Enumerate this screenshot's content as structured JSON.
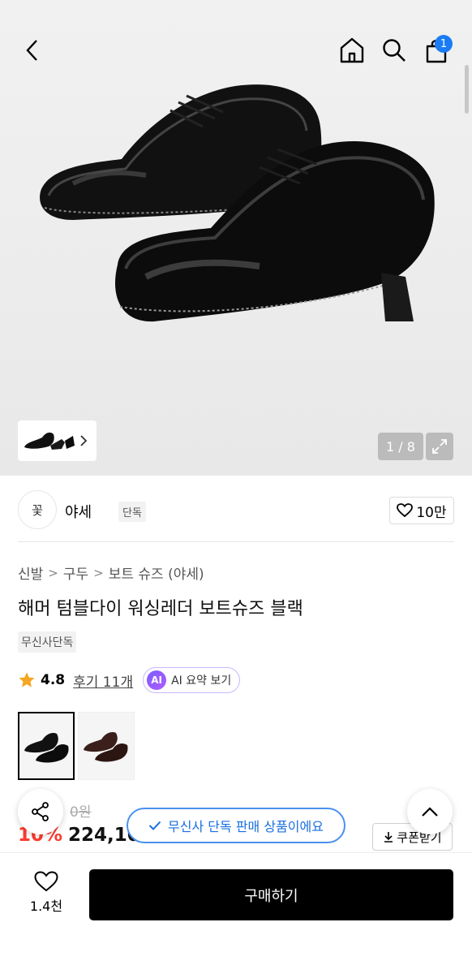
{
  "header": {
    "cart_count": "1"
  },
  "gallery": {
    "counter": "1 / 8"
  },
  "brand": {
    "logo_text": "꽃",
    "name": "야세",
    "tag": "단독",
    "like_count": "10만"
  },
  "breadcrumb": [
    "신발",
    "구두",
    "보트 슈즈 (야세)"
  ],
  "product": {
    "title": "해머 텀블다이 워싱레더 보트슈즈 블랙",
    "exclusive_tag": "무신사단독",
    "rating": "4.8",
    "reviews": "후기 11개",
    "ai_label": "AI",
    "ai_button": "AI 요약 보기",
    "original_price": "0원",
    "discount": "10%",
    "price": "224,10",
    "coupon_button": "쿠폰받기"
  },
  "toast": {
    "text": "무신사 단독 판매 상품이에요"
  },
  "bottom": {
    "wish_count": "1.4천",
    "buy_label": "구매하기"
  },
  "colors": {
    "accent_blue": "#1a7cf5",
    "discount_red": "#ff3b30",
    "star_orange": "#f5a623"
  }
}
